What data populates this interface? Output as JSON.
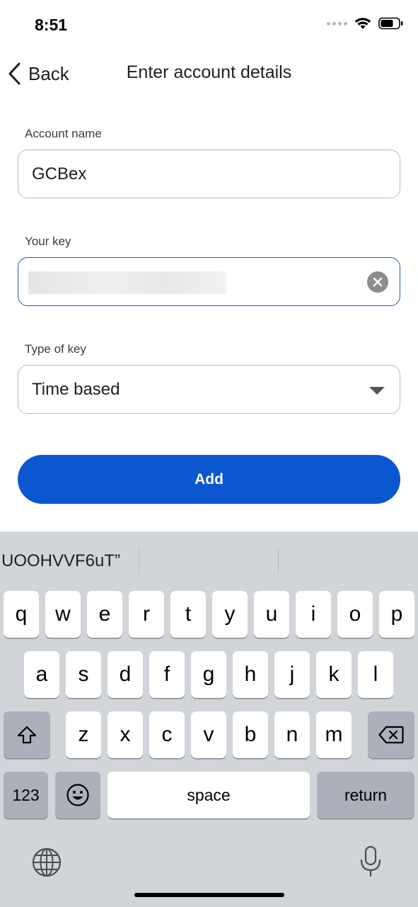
{
  "status_bar": {
    "time": "8:51"
  },
  "header": {
    "back_label": "Back",
    "title": "Enter account details"
  },
  "form": {
    "account_name_label": "Account name",
    "account_name_value": "GCBex",
    "key_label": "Your key",
    "key_type_label": "Type of key",
    "key_type_value": "Time based"
  },
  "add_button_label": "Add",
  "keyboard": {
    "suggestion": "UOOHVVF6uT”",
    "row1": [
      "q",
      "w",
      "e",
      "r",
      "t",
      "y",
      "u",
      "i",
      "o",
      "p"
    ],
    "row2": [
      "a",
      "s",
      "d",
      "f",
      "g",
      "h",
      "j",
      "k",
      "l"
    ],
    "row3": [
      "z",
      "x",
      "c",
      "v",
      "b",
      "n",
      "m"
    ],
    "numbers_label": "123",
    "space_label": "space",
    "return_label": "return"
  },
  "colors": {
    "accent": "#0b57d0",
    "focus_border": "#1a5fb4",
    "keyboard_bg": "#d1d4d9"
  }
}
